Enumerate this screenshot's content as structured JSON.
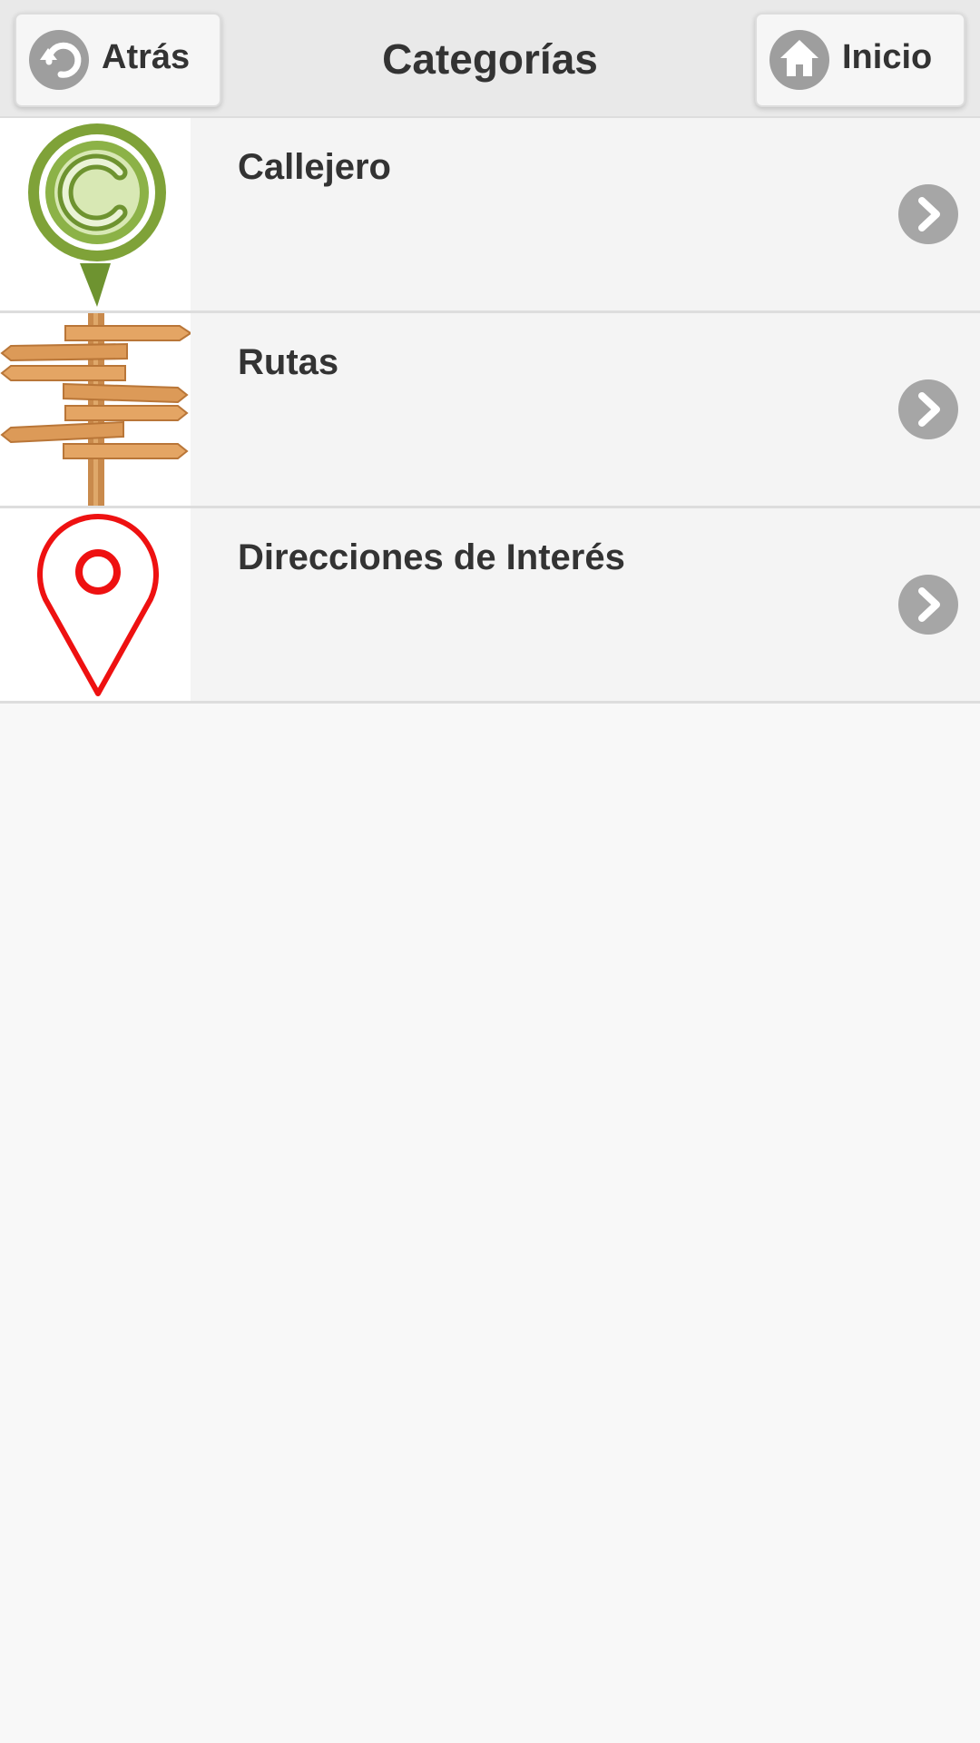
{
  "header": {
    "title": "Categorías",
    "back_label": "Atrás",
    "back_icon": "back-arrow-icon",
    "home_label": "Inicio",
    "home_icon": "home-icon"
  },
  "categories": [
    {
      "label": "Callejero",
      "icon": "street-map-pin-c-icon"
    },
    {
      "label": "Rutas",
      "icon": "wooden-signpost-icon"
    },
    {
      "label": "Direcciones de Interés",
      "icon": "red-location-pin-icon"
    }
  ],
  "colors": {
    "header_bg": "#e9e9e9",
    "row_bg": "#f4f4f4",
    "page_bg": "#f8f8f8",
    "icon_gray": "#9e9e9e",
    "pin_green": "#7fa238",
    "pin_red": "#ee1111",
    "wood": "#e0a060"
  }
}
